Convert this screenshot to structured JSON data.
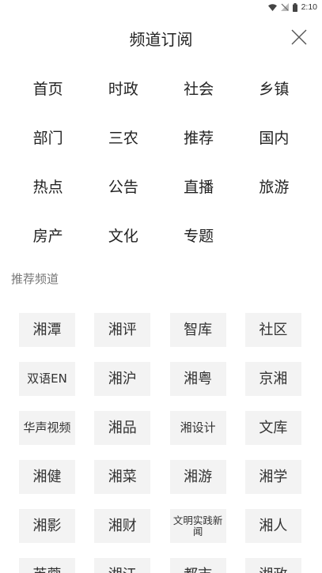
{
  "status_bar": {
    "time": "2:10"
  },
  "header": {
    "title": "频道订阅"
  },
  "subscribed": [
    "首页",
    "时政",
    "社会",
    "乡镇",
    "部门",
    "三农",
    "推荐",
    "国内",
    "热点",
    "公告",
    "直播",
    "旅游",
    "房产",
    "文化",
    "专题"
  ],
  "recommended_section": {
    "title": "推荐频道"
  },
  "recommended": [
    "湘潭",
    "湘评",
    "智库",
    "社区",
    "双语EN",
    "湘沪",
    "湘粤",
    "京湘",
    "华声视频",
    "湘品",
    "湘设计",
    "文库",
    "湘健",
    "湘菜",
    "湘游",
    "湘学",
    "湘影",
    "湘财",
    "文明实践新闻",
    "湘人",
    "芙蓉",
    "湘江",
    "都市",
    "湘政"
  ]
}
